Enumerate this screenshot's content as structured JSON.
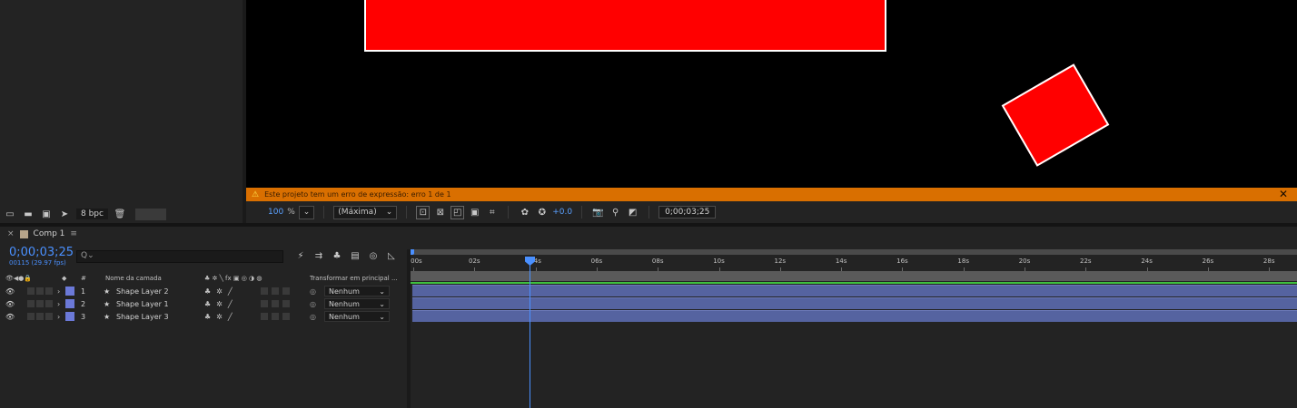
{
  "project": {
    "bpc": "8 bpc",
    "toolbar_icons": [
      "interpret-footage-icon",
      "new-folder-icon",
      "new-comp-icon",
      "flowchart-icon"
    ],
    "trash_icon": "trash-icon"
  },
  "viewer": {
    "error_message": "Este projeto tem um erro de expressão: erro 1 de 1",
    "error_close": "✕",
    "zoom_value": "100",
    "zoom_unit": "%",
    "resolution": "(Máxima)",
    "exposure": "+0.0",
    "timecode": "0;00;03;25"
  },
  "timeline": {
    "tab_title": "Comp 1",
    "current_time": "0;00;03;25",
    "frames_info": "00115 (29.97 fps)",
    "search_placeholder": "Q⌄",
    "columns": {
      "hash": "#",
      "layer_name": "Nome da camada",
      "parent": "Transformar em principal ..."
    },
    "layers": [
      {
        "num": "1",
        "name": "Shape Layer 2",
        "parent": "Nenhum"
      },
      {
        "num": "2",
        "name": "Shape Layer 1",
        "parent": "Nenhum"
      },
      {
        "num": "3",
        "name": "Shape Layer 3",
        "parent": "Nenhum"
      }
    ],
    "ruler_labels": [
      "0:00s",
      "02s",
      "04s",
      "06s",
      "08s",
      "10s",
      "12s",
      "14s",
      "16s",
      "18s",
      "20s",
      "22s",
      "24s",
      "26s",
      "28s"
    ],
    "colors": {
      "accent": "#4a90ff",
      "layer_label": "#6b79d8",
      "layer_bar": "#5563a0",
      "warning": "#d96f00"
    }
  }
}
